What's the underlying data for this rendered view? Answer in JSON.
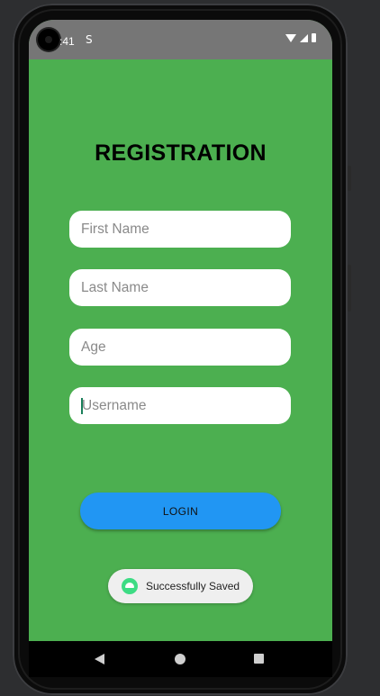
{
  "status_bar": {
    "time": ":41",
    "sync_icon": "sync-icon",
    "wifi_icon": "wifi-icon",
    "signal_icon": "signal-icon",
    "battery_icon": "battery-icon"
  },
  "screen": {
    "background_color": "#4caf50",
    "title": "REGISTRATION",
    "fields": [
      {
        "placeholder": "First Name",
        "value": ""
      },
      {
        "placeholder": "Last Name",
        "value": ""
      },
      {
        "placeholder": "Age",
        "value": ""
      },
      {
        "placeholder": "Username",
        "value": "",
        "focused": true
      }
    ],
    "login_label": "LOGIN",
    "login_color": "#2196f3"
  },
  "toast": {
    "text": "Successfully Saved",
    "icon": "android-icon"
  },
  "nav_bar": {
    "back_icon": "back-icon",
    "home_icon": "home-icon",
    "recents_icon": "recents-icon"
  }
}
